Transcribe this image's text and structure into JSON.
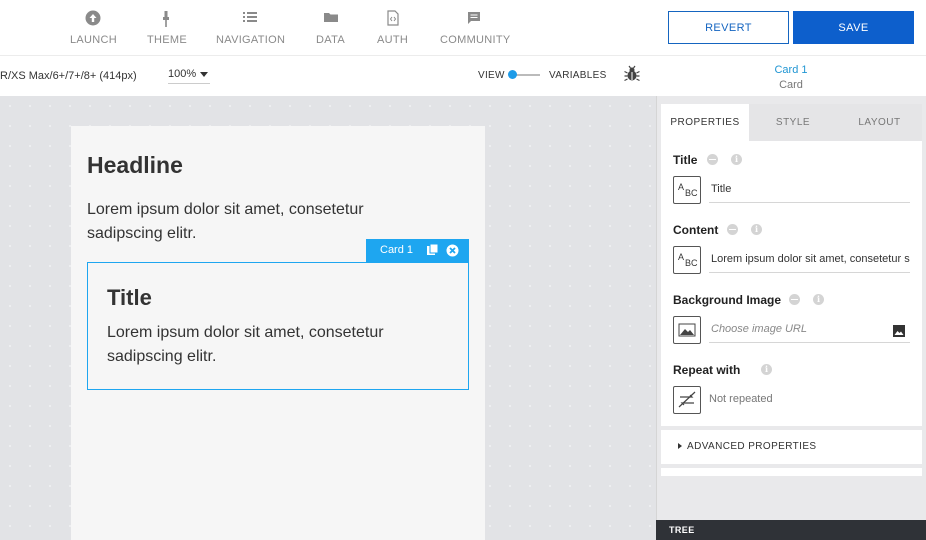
{
  "nav": [
    {
      "label": "LAUNCH",
      "icon": "upload-circle-icon"
    },
    {
      "label": "THEME",
      "icon": "brush-icon"
    },
    {
      "label": "NAVIGATION",
      "icon": "list-icon"
    },
    {
      "label": "DATA",
      "icon": "folder-icon"
    },
    {
      "label": "AUTH",
      "icon": "code-file-icon"
    },
    {
      "label": "COMMUNITY",
      "icon": "chat-icon"
    }
  ],
  "actions": {
    "revert_label": "REVERT",
    "save_label": "SAVE"
  },
  "toolbar": {
    "device": "R/XS Max/6+/7+/8+ (414px)",
    "zoom": "100%",
    "view_label": "VIEW",
    "variables_label": "VARIABLES"
  },
  "selection": {
    "name": "Card 1",
    "type": "Card"
  },
  "screen": {
    "headline": "Headline",
    "body": "Lorem ipsum dolor sit amet, consetetur sadipscing elitr.",
    "card": {
      "tag": "Card 1",
      "title": "Title",
      "content": "Lorem ipsum dolor sit amet, consetetur sadipscing elitr."
    }
  },
  "panel": {
    "tabs": [
      "PROPERTIES",
      "STYLE",
      "LAYOUT"
    ],
    "active_tab": "PROPERTIES",
    "props": {
      "title_label": "Title",
      "title_value": "Title",
      "content_label": "Content",
      "content_value": "Lorem ipsum dolor sit amet, consetetur sadipscing elitr.",
      "bg_label": "Background Image",
      "bg_placeholder": "Choose image URL",
      "repeat_label": "Repeat with",
      "repeat_value": "Not repeated"
    },
    "advanced_label": "ADVANCED PROPERTIES",
    "tree_label": "TREE"
  },
  "colors": {
    "accent": "#1ea6f0",
    "save": "#0d5fcc",
    "revert": "#1565c0"
  }
}
